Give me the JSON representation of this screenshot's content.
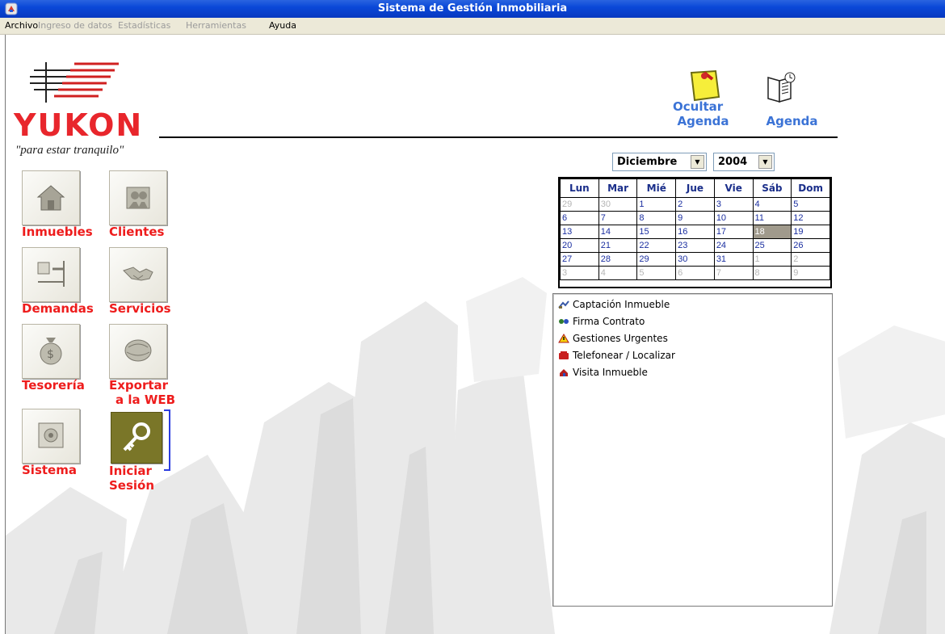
{
  "window": {
    "title": "Sistema de Gestión Inmobiliaria"
  },
  "menu": [
    {
      "label": "Archivo",
      "enabled": true
    },
    {
      "label": "Ingreso de datos",
      "enabled": false
    },
    {
      "label": "Estadísticas",
      "enabled": false
    },
    {
      "label": "Herramientas",
      "enabled": false
    },
    {
      "label": "Ayuda",
      "enabled": true
    }
  ],
  "brand": {
    "name": "YUKON",
    "slogan": "\"para estar tranquilo\"",
    "color": "#e8262c"
  },
  "header_buttons": {
    "ocultar_agenda": {
      "line1": "Ocultar",
      "line2": "Agenda"
    },
    "agenda": {
      "label": "Agenda"
    }
  },
  "modules": [
    {
      "label": "Inmuebles",
      "icon": "house-icon"
    },
    {
      "label": "Clientes",
      "icon": "clients-icon"
    },
    {
      "label": "Demandas",
      "icon": "demands-icon"
    },
    {
      "label": "Servicios",
      "icon": "handshake-icon"
    },
    {
      "label": "Tesorería",
      "icon": "money-bag-icon"
    },
    {
      "label": "Exportar a la WEB",
      "line1": "Exportar",
      "line2": "a la WEB",
      "icon": "web-export-icon"
    },
    {
      "label": "Sistema",
      "icon": "safe-icon"
    },
    {
      "label": "Iniciar Sesión",
      "line1": "Iniciar",
      "line2": "Sesión",
      "icon": "key-icon"
    }
  ],
  "calendar": {
    "month": "Diciembre",
    "year": "2004",
    "weekdays": [
      "Lun",
      "Mar",
      "Mié",
      "Jue",
      "Vie",
      "Sáb",
      "Dom"
    ],
    "weeks": [
      [
        "29",
        "30",
        "1",
        "2",
        "3",
        "4",
        "5"
      ],
      [
        "6",
        "7",
        "8",
        "9",
        "10",
        "11",
        "12"
      ],
      [
        "13",
        "14",
        "15",
        "16",
        "17",
        "18",
        "19"
      ],
      [
        "20",
        "21",
        "22",
        "23",
        "24",
        "25",
        "26"
      ],
      [
        "27",
        "28",
        "29",
        "30",
        "31",
        "1",
        "2"
      ],
      [
        "3",
        "4",
        "5",
        "6",
        "7",
        "8",
        "9"
      ]
    ],
    "today": "18"
  },
  "legend": [
    {
      "label": "Captación Inmueble",
      "icon": "capture-icon"
    },
    {
      "label": "Firma Contrato",
      "icon": "signature-icon"
    },
    {
      "label": "Gestiones Urgentes",
      "icon": "warning-icon"
    },
    {
      "label": "Telefonear / Localizar",
      "icon": "phone-icon"
    },
    {
      "label": "Visita Inmueble",
      "icon": "visit-icon"
    }
  ],
  "colors": {
    "title_bar": "#0a48d8",
    "module_label": "#ee1c1c",
    "header_label": "#3b73d6",
    "calendar_text": "#1a2ea0",
    "calendar_today": "#a09a8c",
    "selected_tile": "#7a7628"
  }
}
